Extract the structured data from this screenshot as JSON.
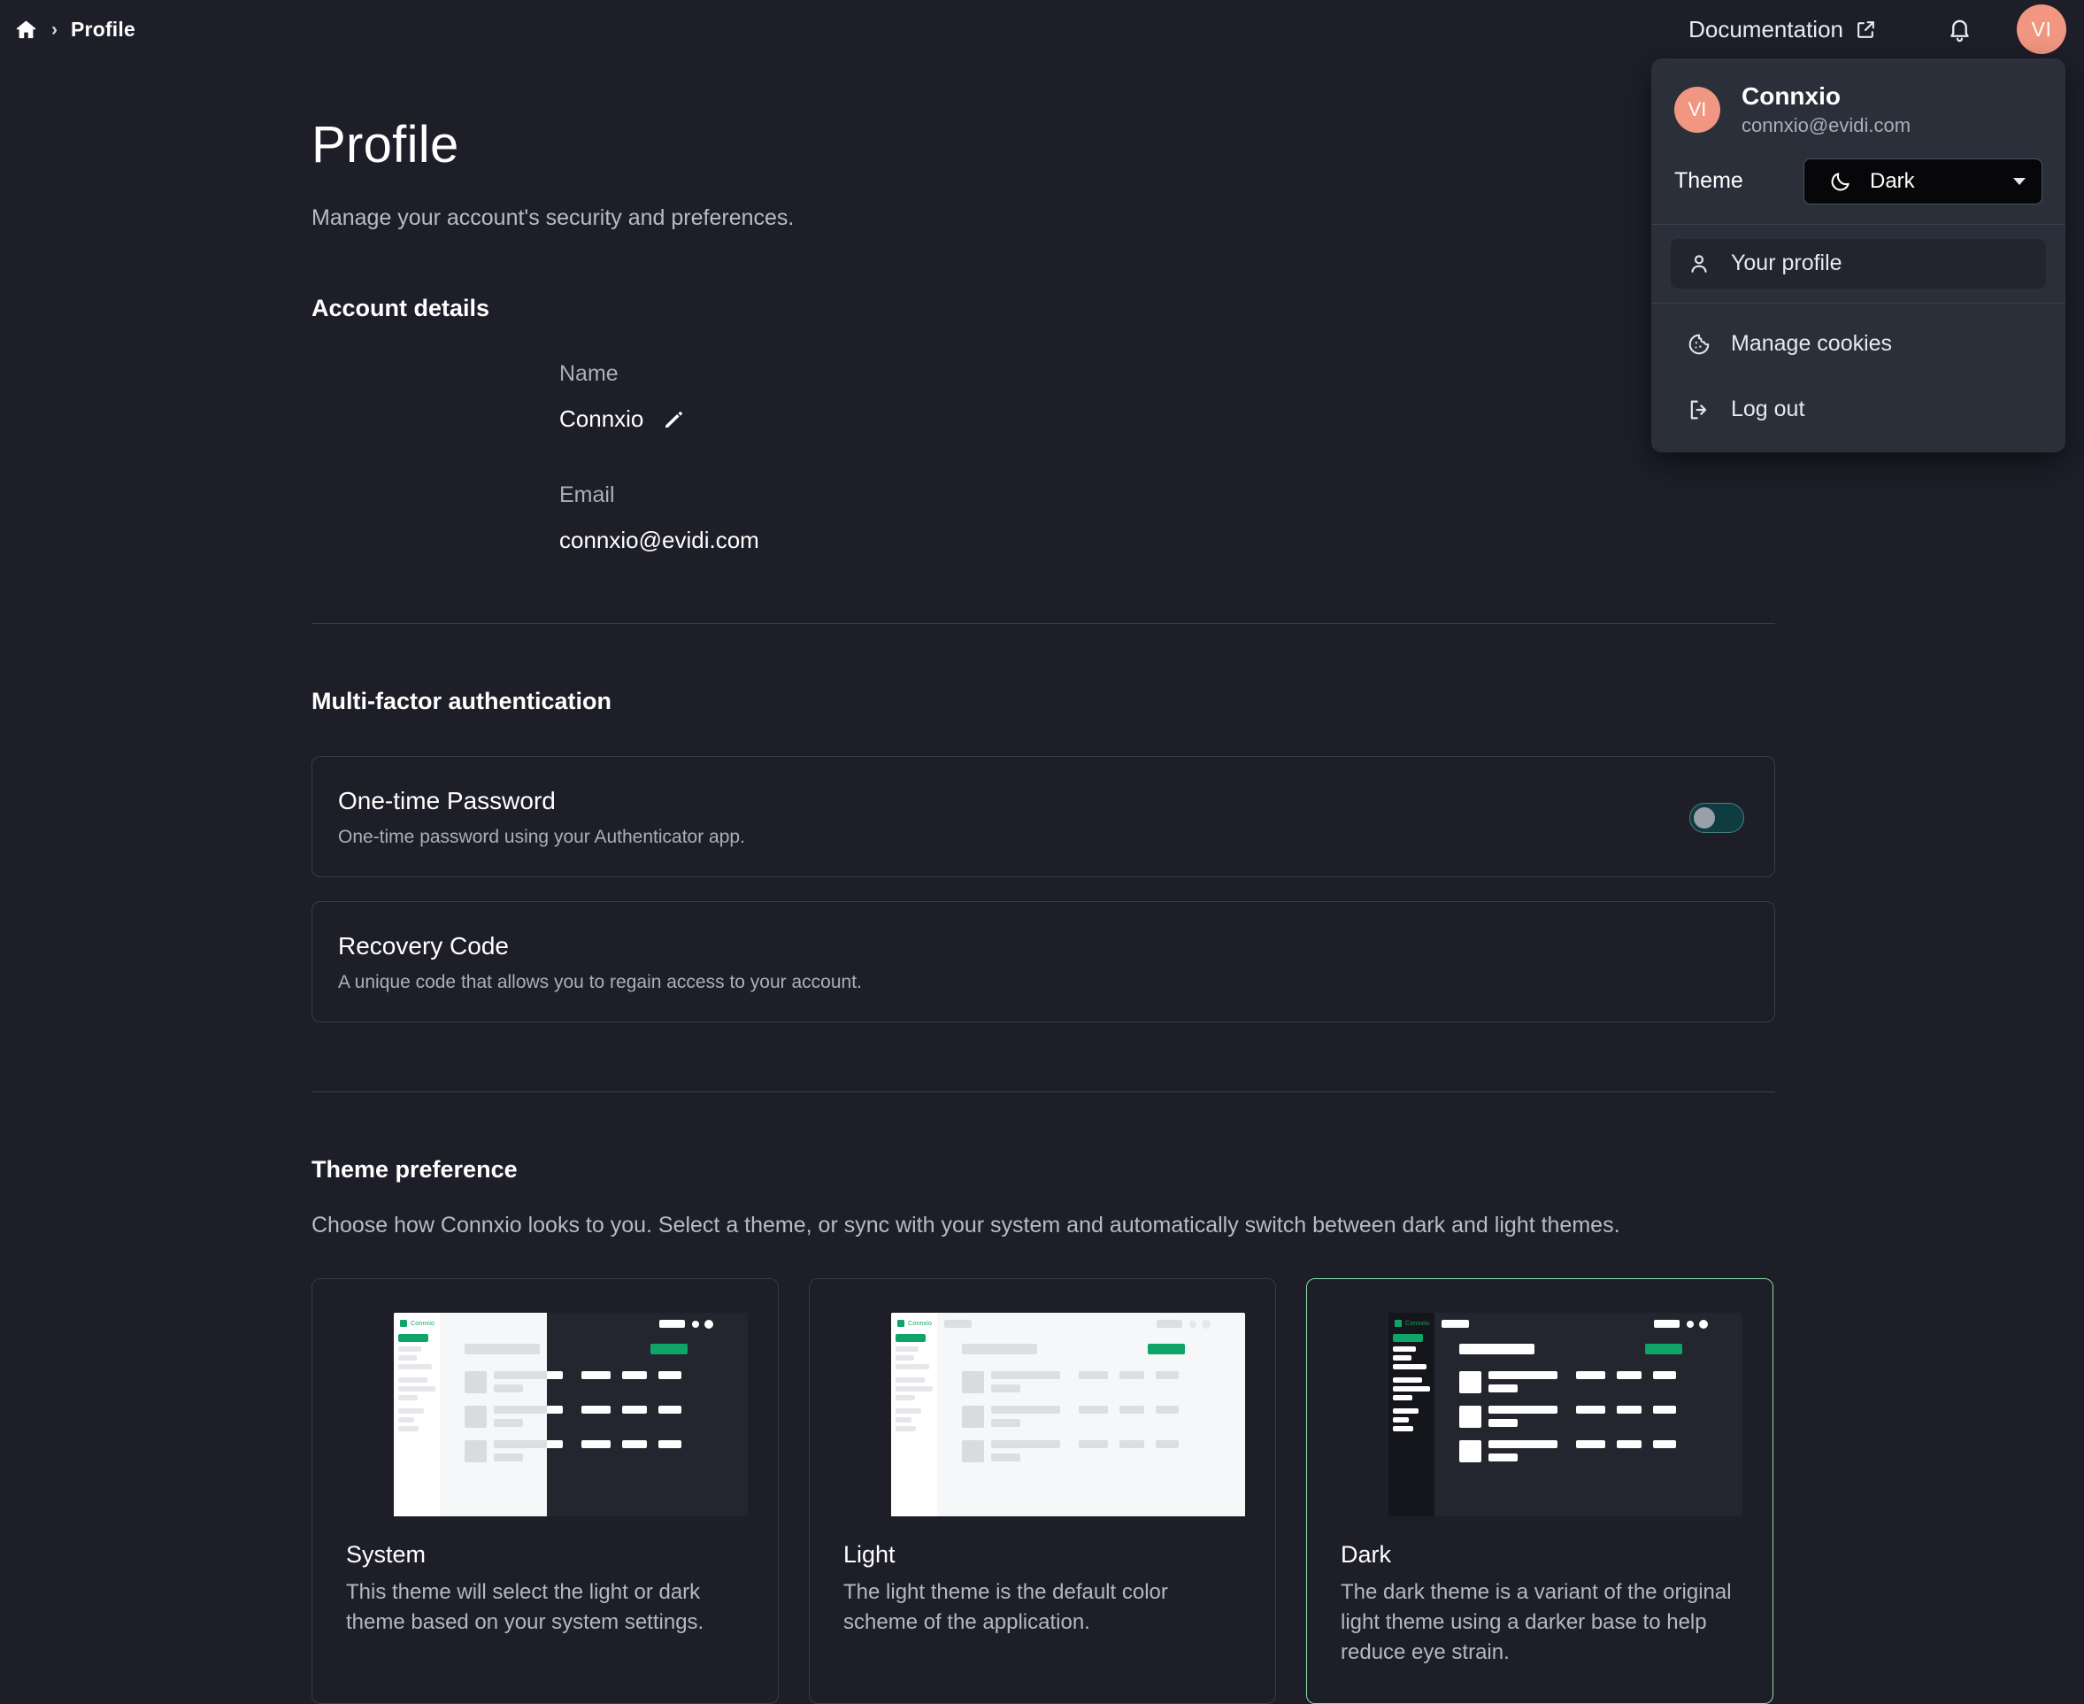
{
  "topbar": {
    "home_icon": "home-icon",
    "separator": "›",
    "breadcrumb": "Profile",
    "documentation_label": "Documentation",
    "external_icon": "external-link-icon",
    "bell_icon": "bell-icon",
    "avatar_initials": "VI",
    "avatar_color": "#f19680"
  },
  "profile_menu": {
    "avatar_initials": "VI",
    "name": "Connxio",
    "email": "connxio@evidi.com",
    "theme_label": "Theme",
    "theme_value": "Dark",
    "theme_icon": "moon-icon",
    "items": [
      {
        "label": "Your profile",
        "icon": "user-icon",
        "active": true
      },
      {
        "label": "Manage cookies",
        "icon": "cookie-icon",
        "active": false
      },
      {
        "label": "Log out",
        "icon": "logout-icon",
        "active": false
      }
    ]
  },
  "page": {
    "title": "Profile",
    "subtitle": "Manage your account's security and preferences."
  },
  "account_details": {
    "heading": "Account details",
    "name_label": "Name",
    "name_value": "Connxio",
    "edit_icon": "pencil-icon",
    "email_label": "Email",
    "email_value": "connxio@evidi.com"
  },
  "mfa": {
    "heading": "Multi-factor authentication",
    "cards": [
      {
        "title": "One-time Password",
        "description": "One-time password using your Authenticator app.",
        "has_toggle": true,
        "toggle_on": false
      },
      {
        "title": "Recovery Code",
        "description": "A unique code that allows you to regain access to your account.",
        "has_toggle": false
      }
    ]
  },
  "theme_preference": {
    "heading": "Theme preference",
    "description": "Choose how Connxio looks to you. Select a theme, or sync with your system and automatically switch between dark and light themes.",
    "selected": "Dark",
    "accent_selected_border": "#8fe0a9",
    "mock_accent": "#0fa568",
    "options": [
      {
        "title": "System",
        "description": "This theme will select the light or dark theme based on your system settings.",
        "preview": "split",
        "selected": false
      },
      {
        "title": "Light",
        "description": "The light theme is the default color scheme of the application.",
        "preview": "light",
        "selected": false
      },
      {
        "title": "Dark",
        "description": "The dark theme is a variant of the original light theme using a darker base to help reduce eye strain.",
        "preview": "dark",
        "selected": true
      }
    ],
    "mock_logo_text": "Connxio"
  },
  "colors": {
    "page_bg": "#1d1e28",
    "menu_bg": "#2b2f3a",
    "border": "#373c48",
    "divider": "#3a3f4c",
    "toggle_track": "#0f3c40"
  }
}
